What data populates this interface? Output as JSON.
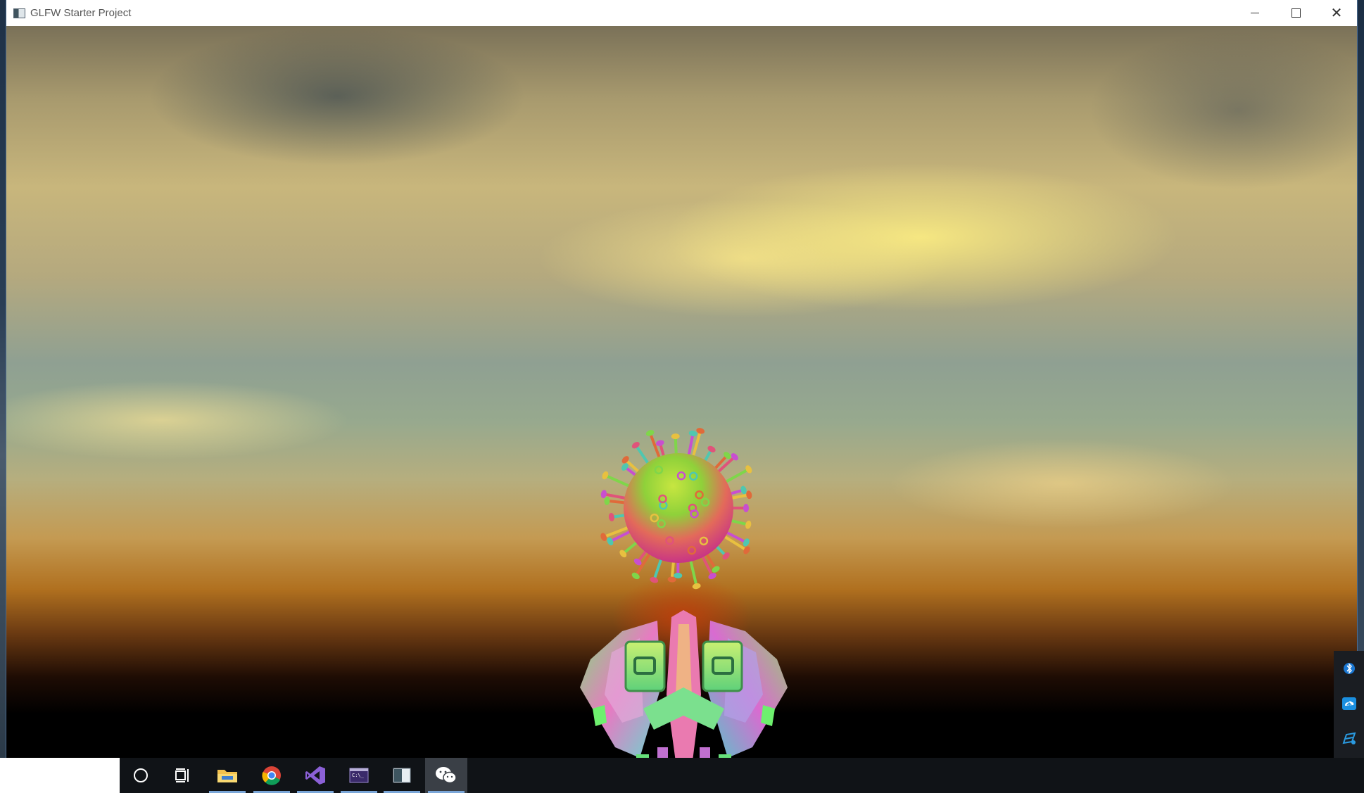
{
  "window": {
    "title": "GLFW Starter Project",
    "controls": {
      "minimize": "minimize-icon",
      "maximize": "maximize-icon",
      "close": "close-icon"
    },
    "close_glyph": "✕"
  },
  "scene": {
    "background": "sunset-skybox",
    "objects": [
      "virus-model",
      "spaceship-model"
    ]
  },
  "taskbar": {
    "items": [
      {
        "name": "cortana",
        "icon": "circle-icon"
      },
      {
        "name": "task-view",
        "icon": "task-view-icon"
      },
      {
        "name": "file-explorer",
        "icon": "folder-icon"
      },
      {
        "name": "chrome",
        "icon": "chrome-icon"
      },
      {
        "name": "visual-studio",
        "icon": "visual-studio-icon"
      },
      {
        "name": "terminal",
        "icon": "terminal-icon"
      },
      {
        "name": "glfw-app",
        "icon": "app-window-icon"
      },
      {
        "name": "wechat",
        "icon": "wechat-icon"
      }
    ]
  },
  "tray": {
    "items": [
      {
        "name": "bluetooth",
        "icon": "bluetooth-icon"
      },
      {
        "name": "cloud-sync",
        "icon": "cloud-sync-icon"
      },
      {
        "name": "network-app",
        "icon": "network-icon"
      }
    ]
  },
  "colors": {
    "accent": "#7aa6d8",
    "taskbar": "#101317",
    "titlebar": "#ffffff"
  }
}
